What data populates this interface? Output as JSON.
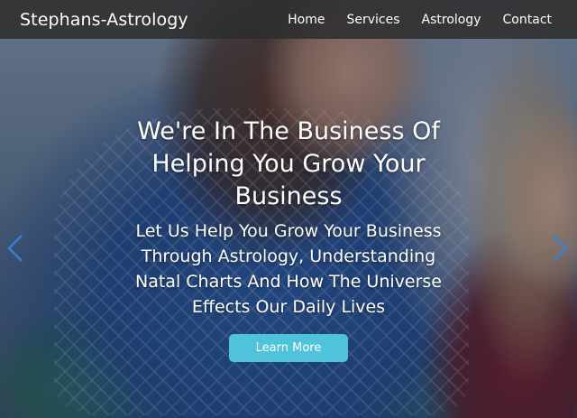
{
  "navbar": {
    "brand": "Stephans-Astrology",
    "links": [
      {
        "label": "Home"
      },
      {
        "label": "Services"
      },
      {
        "label": "Astrology"
      },
      {
        "label": "Contact"
      }
    ]
  },
  "hero": {
    "title": "We're In The Business Of Helping You Grow Your Business",
    "subtitle": "Let Us Help You Grow Your Business Through Astrology, Understanding Natal Charts And How The Universe Effects Our Daily Lives",
    "cta_label": "Learn More"
  },
  "carousel": {
    "prev_icon": "chevron-left-icon",
    "next_icon": "chevron-right-icon"
  },
  "colors": {
    "navbar_bg": "#2d2d2d",
    "cta_bg": "#4fc3d9",
    "arrow": "#3a7fd6",
    "text": "#ffffff"
  }
}
